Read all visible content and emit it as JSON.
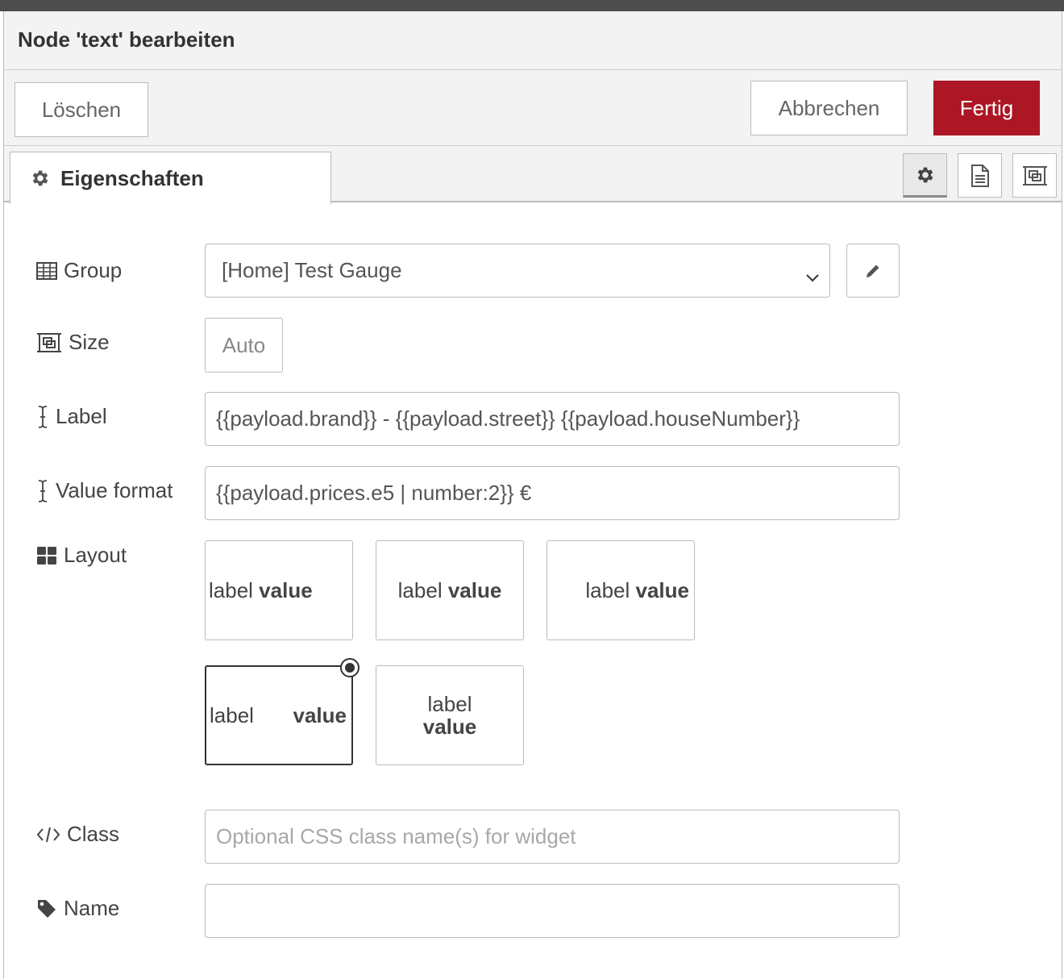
{
  "dialog": {
    "title": "Node 'text' bearbeiten",
    "delete_label": "Löschen",
    "cancel_label": "Abbrechen",
    "done_label": "Fertig",
    "done_color": "#ad1625"
  },
  "tabs": {
    "properties_label": "Eigenschaften",
    "icons": [
      "gear-icon",
      "description-icon",
      "appearance-icon"
    ]
  },
  "form": {
    "group": {
      "label": "Group",
      "value": "[Home] Test Gauge"
    },
    "size": {
      "label": "Size",
      "value": "Auto"
    },
    "label_field": {
      "label": "Label",
      "value": "{{payload.brand}} - {{payload.street}} {{payload.houseNumber}}"
    },
    "value_format": {
      "label": "Value format",
      "value": "{{payload.prices.e5 | number:2}} €"
    },
    "layout": {
      "label": "Layout",
      "options": [
        {
          "label": "label",
          "value": "value"
        },
        {
          "label": "label",
          "value": "value"
        },
        {
          "label": "label",
          "value": "value"
        },
        {
          "label": "label",
          "value": "value",
          "selected": true
        },
        {
          "label": "label",
          "value": "value"
        }
      ]
    },
    "class_field": {
      "label": "Class",
      "placeholder": "Optional CSS class name(s) for widget",
      "value": ""
    },
    "name": {
      "label": "Name",
      "value": ""
    }
  }
}
